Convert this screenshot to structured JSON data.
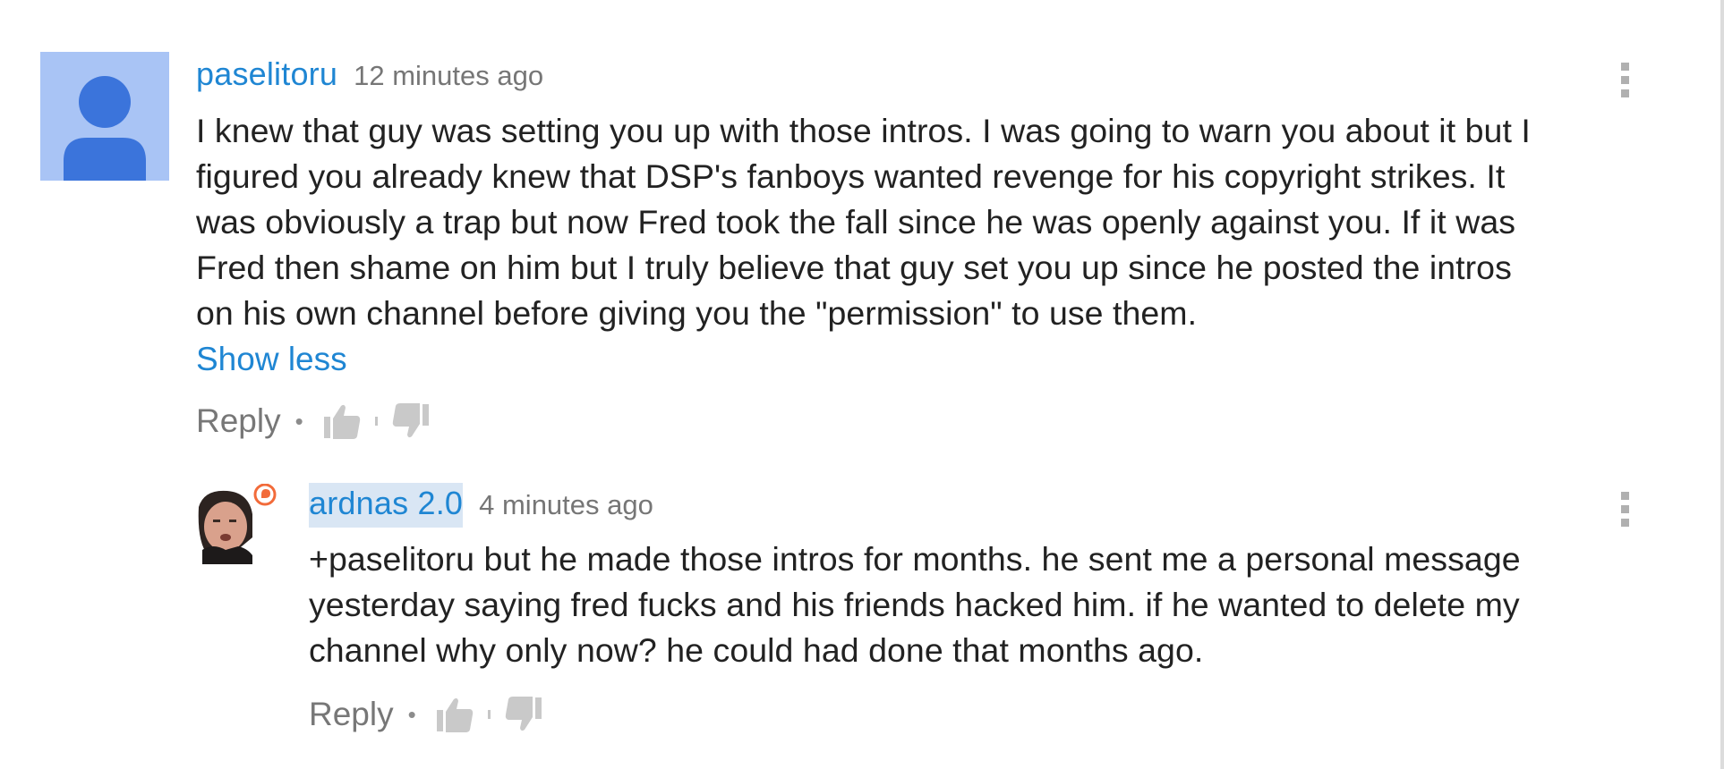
{
  "comments": [
    {
      "author": "paselitoru",
      "timestamp": "12 minutes ago",
      "text_lines": [
        "I knew that guy was setting you up with those intros. I was going to warn you about it but I",
        "figured you already knew that DSP's fanboys wanted revenge for his copyright strikes. It",
        "was obviously a trap but now Fred took the fall since he was openly against you. If it was",
        "Fred then shame on him but I truly believe that guy set you up since he posted the intros",
        "on his own channel before giving you the \"permission\" to use them."
      ],
      "show_less": "Show less",
      "reply_label": "Reply",
      "separator": "•"
    }
  ],
  "replies": [
    {
      "author": "ardnas 2.0",
      "timestamp": "4 minutes ago",
      "text_lines": [
        "+paselitoru but he made those intros for months. he sent me a personal message",
        "yesterday saying fred fucks and his friends hacked him. if he wanted to delete my",
        "channel why only now? he could had done that months ago."
      ],
      "reply_label": "Reply",
      "separator": "•"
    }
  ],
  "colors": {
    "link_blue": "#1f86d3",
    "timestamp_gray": "#767676",
    "text": "#222222",
    "avatar_bg": "#a9c4f5",
    "avatar_figure": "#3b74db",
    "author_highlight": "#d9e6f4",
    "badge_orange": "#f26b3a"
  },
  "icons": {
    "default_avatar": "person-silhouette-icon",
    "thumbs_up": "thumbs-up-icon",
    "thumbs_down": "thumbs-down-icon",
    "menu": "vertical-ellipsis-icon",
    "badge": "orange-badge-icon"
  }
}
